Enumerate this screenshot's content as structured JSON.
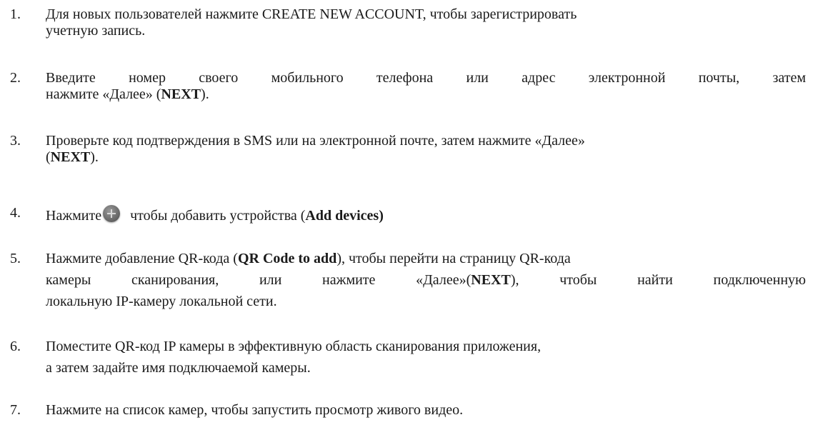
{
  "items": [
    {
      "num": "1.",
      "lines": [
        "Для новых пользователей нажмите CREATE NEW ACCOUNT, чтобы зарегистрировать",
        "учетную запись."
      ]
    },
    {
      "num": "2.",
      "line1": "Введите номер своего мобильного телефона или адрес электронной почты, затем",
      "line2_pre": "нажмите «Далее» (",
      "line2_bold": "NEXT",
      "line2_post": ")."
    },
    {
      "num": "3.",
      "line1": "Проверьте код подтверждения в SMS или на электронной почте, затем нажмите «Далее»",
      "line2_pre": "(",
      "line2_bold": "NEXT",
      "line2_post": ")."
    },
    {
      "num": "4.",
      "pre": "Нажмите",
      "icon": "plus-circle-icon",
      "mid": "чтобы добавить устройства (",
      "bold": "Add devices)"
    },
    {
      "num": "5.",
      "line1_pre": "Нажмите добавление QR-кода (",
      "line1_bold": "QR Code to add",
      "line1_post": "), чтобы перейти на страницу QR-кода",
      "line2_pre": "камеры сканирования, или нажмите «Далее»(",
      "line2_bold": "NEXT",
      "line2_post": "), чтобы найти подключенную",
      "line3": "локальную IP-камеру локальной сети."
    },
    {
      "num": "6.",
      "lines": [
        "Поместите QR-код IP камеры в эффективную область сканирования приложения,",
        "а затем задайте имя подключаемой камеры."
      ]
    },
    {
      "num": "7.",
      "lines": [
        "Нажмите на список камер, чтобы запустить просмотр живого видео."
      ]
    }
  ]
}
